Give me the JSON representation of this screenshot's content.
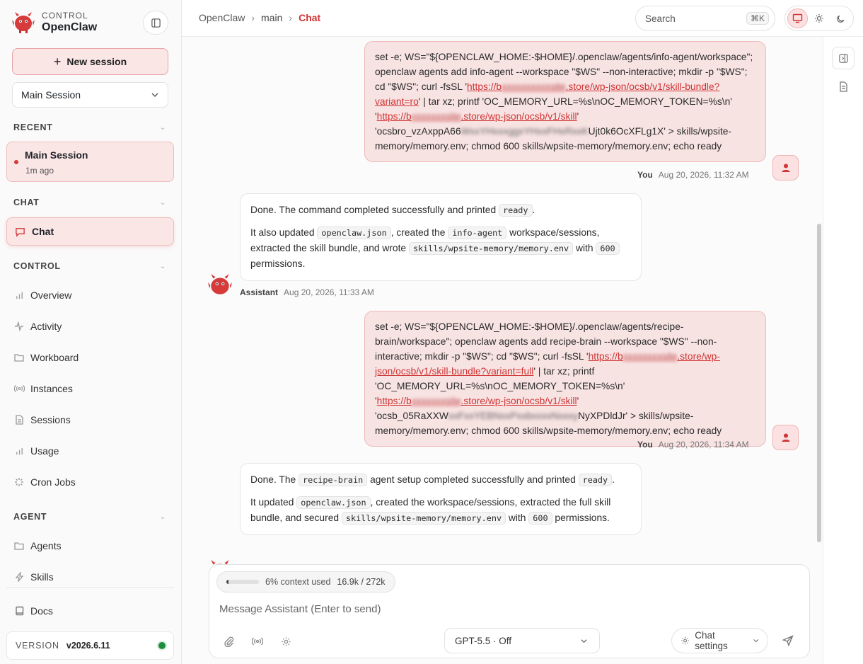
{
  "brand": {
    "kicker": "CONTROL",
    "name": "OpenClaw"
  },
  "sidebar": {
    "new_session": "New session",
    "session_select": "Main Session",
    "sections": {
      "recent": "RECENT",
      "chat": "CHAT",
      "control": "CONTROL",
      "agent": "AGENT"
    },
    "recent_item": {
      "title": "Main Session",
      "time": "1m ago"
    },
    "chat_item": "Chat",
    "control_items": [
      "Overview",
      "Activity",
      "Workboard",
      "Instances",
      "Sessions",
      "Usage",
      "Cron Jobs"
    ],
    "agent_items": [
      "Agents",
      "Skills"
    ],
    "docs": "Docs",
    "version_key": "VERSION",
    "version_value": "v2026.6.11"
  },
  "topbar": {
    "crumbs": [
      "OpenClaw",
      "main",
      "Chat"
    ],
    "search_label": "Search",
    "search_shortcut": "⌘K"
  },
  "messages": [
    {
      "role": "user",
      "p1": "set -e; WS=\"${OPENCLAW_HOME:-$HOME}/.openclaw/agents/info-agent/workspace\"; openclaw agents add info-agent --workspace \"$WS\" --non-interactive; mkdir -p \"$WS\"; cd \"$WS\"; curl -fsSL '",
      "link1_a": "https://b",
      "link1_blur": "xxxxxxxxxxsite",
      "link1_b": ".store/wp-json/ocsb/v1/skill-bundle?variant=ro",
      "p2": "' | tar xz; printf 'OC_MEMORY_URL=%s\\nOC_MEMORY_TOKEN=%s\\n' '",
      "link2_a": "https://b",
      "link2_blur": "xxxxxxxsite",
      "link2_b": ".store/wp-json/ocsb/v1/skill",
      "p3a": "' 'ocsbro_vzAxppA66",
      "p3blur": "WxxYHxxxggxYHxxFHxRxxK",
      "p3b": "Ujt0k6OcXFLg1X' > skills/wpsite-memory/memory.env; chmod 600 skills/wpsite-memory/memory.env; echo ready",
      "author": "You",
      "time": "Aug 20, 2026, 11:32 AM"
    },
    {
      "role": "assistant",
      "line1_a": "Done. The command completed successfully and printed ",
      "line1_code": "ready",
      "line1_b": ".",
      "line2_a": "It also updated ",
      "line2_code1": "openclaw.json",
      "line2_b": ", created the ",
      "line2_code2": "info-agent",
      "line2_c": " workspace/sessions, extracted the skill bundle, and wrote ",
      "line2_code3": "skills/wpsite-memory/memory.env",
      "line2_d": " with ",
      "line2_code4": "600",
      "line2_e": " permissions.",
      "author": "Assistant",
      "time": "Aug 20, 2026, 11:33 AM"
    },
    {
      "role": "user",
      "p1": "set -e; WS=\"${OPENCLAW_HOME:-$HOME}/.openclaw/agents/recipe-brain/workspace\"; openclaw agents add recipe-brain --workspace \"$WS\" --non-interactive; mkdir -p \"$WS\"; cd \"$WS\"; curl -fsSL '",
      "link1_a": "https://b",
      "link1_blur": "xxxxxxxxsite",
      "link1_b": ".store/wp-json/ocsb/v1/skill-bundle?variant=full",
      "p2": "' | tar xz; printf 'OC_MEMORY_URL=%s\\nOC_MEMORY_TOKEN=%s\\n' '",
      "link2_a": "https://b",
      "link2_blur": "xxxxxxxsite",
      "link2_b": ".store/wp-json/ocsb/v1/skill",
      "p3a": "' 'ocsb_05RaXXW",
      "p3blur": "xxFxxYEBNxxPxxbxxxxNxxxy",
      "p3b": "NyXPDldJr' > skills/wpsite-memory/memory.env; chmod 600 skills/wpsite-memory/memory.env; echo ready",
      "author": "You",
      "time": "Aug 20, 2026, 11:34 AM"
    },
    {
      "role": "assistant",
      "line1_a": "Done. The ",
      "line1_code": "recipe-brain",
      "line1_b": " agent setup completed successfully and printed ",
      "line1_code2": "ready",
      "line1_c": ".",
      "line2_a": "It updated ",
      "line2_code1": "openclaw.json",
      "line2_b": ", created the workspace/sessions, extracted the full skill bundle, and secured ",
      "line2_code2": "skills/wpsite-memory/memory.env",
      "line2_c": " with ",
      "line2_code3": "600",
      "line2_d": " permissions."
    }
  ],
  "composer": {
    "context_fraction": 0.06,
    "context_label": "6% context used",
    "context_tokens": "16.9k / 272k",
    "placeholder": "Message Assistant (Enter to send)",
    "model": "GPT-5.5 · Off",
    "settings": "Chat settings"
  },
  "colors": {
    "accent": "#d03434",
    "accent_bg": "#fbe6e6",
    "online": "#1e8e3e"
  }
}
